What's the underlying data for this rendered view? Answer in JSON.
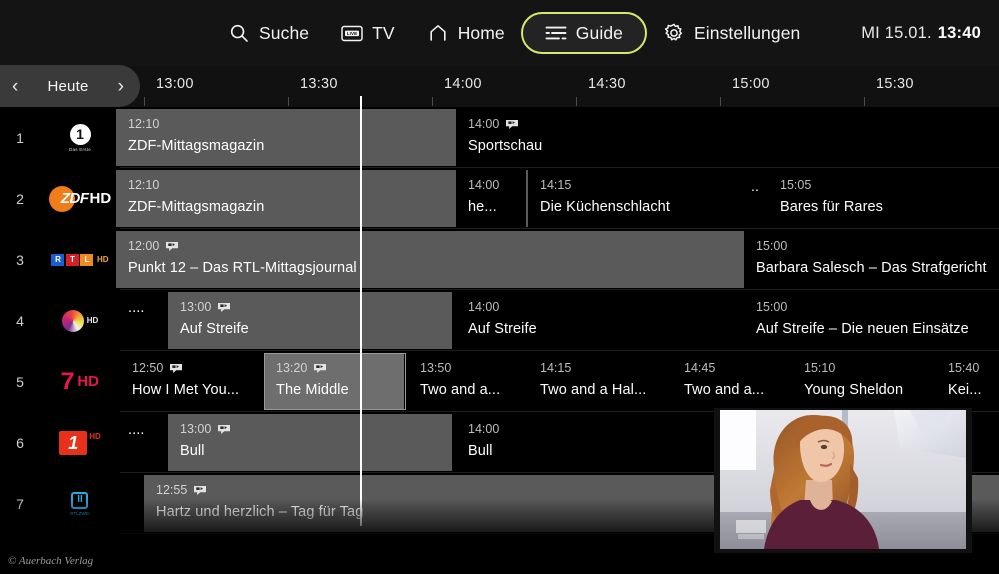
{
  "nav": {
    "items": [
      {
        "label": "Suche",
        "icon": "search-icon",
        "active": false
      },
      {
        "label": "TV",
        "icon": "live-tv-icon",
        "active": false
      },
      {
        "label": "Home",
        "icon": "home-icon",
        "active": false
      },
      {
        "label": "Guide",
        "icon": "guide-icon",
        "active": true
      },
      {
        "label": "Einstellungen",
        "icon": "gear-icon",
        "active": false
      }
    ],
    "accent_color": "#d7e86a"
  },
  "clock": {
    "date": "MI 15.01.",
    "time": "13:40"
  },
  "datebar": {
    "label": "Heute",
    "prev": "‹",
    "next": "›"
  },
  "timeline": {
    "ticks": [
      "13:00",
      "13:30",
      "14:00",
      "14:30",
      "15:00",
      "15:30"
    ],
    "now": "13:40"
  },
  "channels": [
    {
      "num": "1",
      "name": "Das Erste",
      "logo": "ard-logo"
    },
    {
      "num": "2",
      "name": "ZDF HD",
      "logo": "zdf-logo"
    },
    {
      "num": "3",
      "name": "RTL HD",
      "logo": "rtl-logo"
    },
    {
      "num": "4",
      "name": "SAT.1 HD",
      "logo": "sat1-logo"
    },
    {
      "num": "5",
      "name": "ProSieben HD",
      "logo": "prosieben-logo"
    },
    {
      "num": "6",
      "name": "kabel eins HD",
      "logo": "kabeleins-logo"
    },
    {
      "num": "7",
      "name": "RTLZWEI",
      "logo": "rtl2-logo"
    }
  ],
  "programs": [
    [
      {
        "time": "12:10",
        "title": "ZDF-Mittagsmagazin",
        "replay": false,
        "past": true,
        "selected": false
      },
      {
        "time": "14:00",
        "title": "Sportschau",
        "replay": true,
        "past": false,
        "selected": false
      }
    ],
    [
      {
        "time": "12:10",
        "title": "ZDF-Mittagsmagazin",
        "replay": false,
        "past": true,
        "selected": false
      },
      {
        "time": "14:00",
        "title": "he...",
        "replay": false,
        "past": false,
        "selected": false
      },
      {
        "time": "14:15",
        "title": "Die Küchenschlacht",
        "replay": false,
        "past": false,
        "selected": false
      },
      {
        "time": "",
        "title": "..",
        "replay": false,
        "past": false,
        "selected": false
      },
      {
        "time": "15:05",
        "title": "Bares für Rares",
        "replay": false,
        "past": false,
        "selected": false
      }
    ],
    [
      {
        "time": "12:00",
        "title": "Punkt 12 – Das RTL-Mittagsjournal",
        "replay": true,
        "past": true,
        "selected": false
      },
      {
        "time": "15:00",
        "title": "Barbara Salesch – Das Strafgericht",
        "replay": false,
        "past": false,
        "selected": false
      }
    ],
    [
      {
        "time": "",
        "title": "....",
        "replay": false,
        "past": false,
        "selected": false
      },
      {
        "time": "13:00",
        "title": "Auf Streife",
        "replay": true,
        "past": true,
        "selected": false
      },
      {
        "time": "14:00",
        "title": "Auf Streife",
        "replay": false,
        "past": false,
        "selected": false
      },
      {
        "time": "15:00",
        "title": "Auf Streife – Die neuen Einsätze",
        "replay": false,
        "past": false,
        "selected": false
      }
    ],
    [
      {
        "time": "12:50",
        "title": "How I Met You...",
        "replay": true,
        "past": false,
        "selected": false
      },
      {
        "time": "13:20",
        "title": "The Middle",
        "replay": true,
        "past": true,
        "selected": true
      },
      {
        "time": "13:50",
        "title": "Two and a...",
        "replay": false,
        "past": false,
        "selected": false
      },
      {
        "time": "14:15",
        "title": "Two and a Hal...",
        "replay": false,
        "past": false,
        "selected": false
      },
      {
        "time": "14:45",
        "title": "Two and a...",
        "replay": false,
        "past": false,
        "selected": false
      },
      {
        "time": "15:10",
        "title": "Young Sheldon",
        "replay": false,
        "past": false,
        "selected": false
      },
      {
        "time": "15:40",
        "title": "Kei...",
        "replay": false,
        "past": false,
        "selected": false
      }
    ],
    [
      {
        "time": "",
        "title": "....",
        "replay": false,
        "past": false,
        "selected": false
      },
      {
        "time": "13:00",
        "title": "Bull",
        "replay": true,
        "past": true,
        "selected": false
      },
      {
        "time": "14:00",
        "title": "Bull",
        "replay": false,
        "past": false,
        "selected": false
      }
    ],
    [
      {
        "time": "12:55",
        "title": "Hartz und herzlich – Tag für Tag",
        "replay": true,
        "past": true,
        "selected": false
      }
    ]
  ],
  "pip": {
    "label": "live-preview"
  },
  "watermark": "© Auerbach Verlag"
}
